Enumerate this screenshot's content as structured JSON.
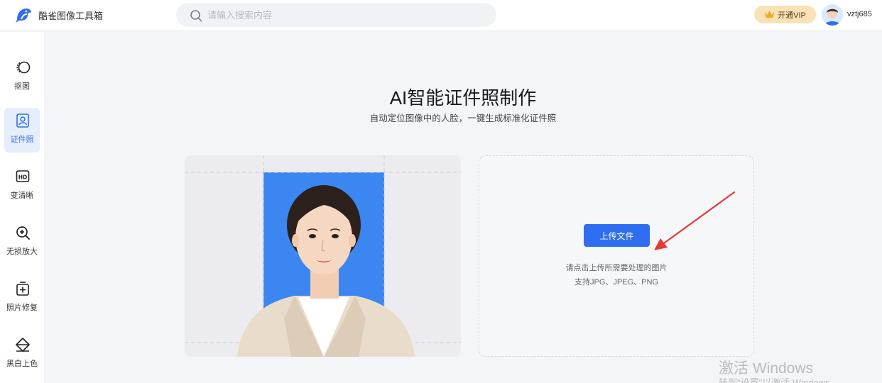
{
  "header": {
    "app_title": "酷雀图像工具箱",
    "search_placeholder": "请输入搜索内容",
    "vip_label": "开通VIP",
    "username": "vztj685",
    "logo_icon": "bird-logo",
    "search_icon": "search-icon",
    "vip_icon": "crown-icon"
  },
  "sidebar": {
    "items": [
      {
        "label": "抠图",
        "icon": "cutout-icon",
        "active": false
      },
      {
        "label": "证件照",
        "icon": "id-photo-icon",
        "active": true
      },
      {
        "label": "变清晰",
        "icon": "hd-icon",
        "active": false
      },
      {
        "label": "无损放大",
        "icon": "zoom-in-icon",
        "active": false
      },
      {
        "label": "照片修复",
        "icon": "photo-repair-icon",
        "active": false
      },
      {
        "label": "黑白上色",
        "icon": "colorize-icon",
        "active": false
      }
    ]
  },
  "main": {
    "title": "AI智能证件照制作",
    "subtitle": "自动定位图像中的人脸，一键生成标准化证件照",
    "upload_button": "上传文件",
    "hint_line1": "请点击上传所需要处理的图片",
    "hint_line2": "支持JPG、JPEG、PNG"
  },
  "watermark": {
    "line1": "激活 Windows",
    "line2": "转到\"设置\"以激活 Windows"
  },
  "colors": {
    "accent": "#2f6ef0",
    "id_photo_background": "#3b86f0",
    "vip_background": "#f9e2b6",
    "annotation_arrow": "#e53935"
  }
}
